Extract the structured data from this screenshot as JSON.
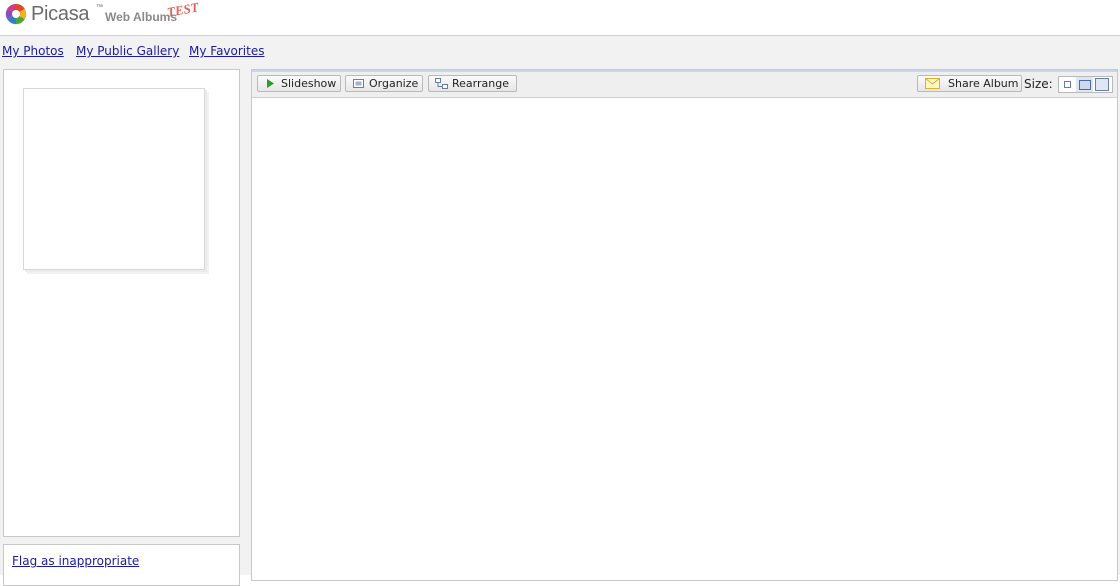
{
  "header": {
    "logo_text": "Picasa",
    "logo_tm": "™",
    "logo_sub": "Web Albums",
    "logo_test": "TEST"
  },
  "nav": {
    "links": [
      "My Photos",
      "My Public Gallery",
      "My Favorites"
    ]
  },
  "toolbar": {
    "slideshow_label": "Slideshow",
    "organize_label": "Organize",
    "rearrange_label": "Rearrange",
    "share_label": "Share Album",
    "size_label": "Size:",
    "size_options": [
      "small",
      "medium",
      "large"
    ],
    "size_selected": "medium"
  },
  "sidebar": {
    "flag_label": "Flag as inappropriate"
  },
  "icons": {
    "slideshow": "play-icon",
    "organize": "organize-icon",
    "rearrange": "rearrange-icon",
    "share": "envelope-icon"
  },
  "colors": {
    "link": "#1c1ca3",
    "accent": "#c7d6ea",
    "play": "#2e9b2e"
  }
}
